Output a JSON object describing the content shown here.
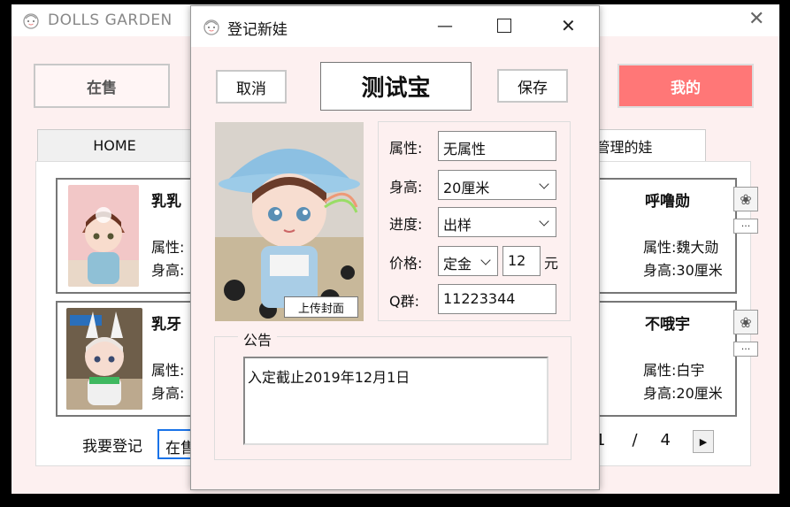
{
  "main": {
    "app_title": "DOLLS GARDEN",
    "buttons": {
      "onsale": "在售",
      "mine": "我的"
    },
    "tabs": {
      "home": "HOME",
      "managed": "管理的娃"
    },
    "cards": [
      {
        "name": "乳乳",
        "attr_label": "属性:",
        "height_label": "身高:"
      },
      {
        "name": "乳牙",
        "attr_label": "属性:",
        "height_label": "身高:"
      },
      {
        "name": "呼噜勋",
        "attr_label": "属性:",
        "attr_value": "魏大勋",
        "height_label": "身高:",
        "height_value": "30厘米",
        "more": "..."
      },
      {
        "name": "不哦宇",
        "attr_label": "属性:",
        "attr_value": "白宇",
        "height_label": "身高:",
        "height_value": "20厘米",
        "more": "..."
      }
    ],
    "register_label": "我要登记",
    "register_value": "在售",
    "pager": {
      "current": "1",
      "separator": "/",
      "total": "4"
    },
    "colors": {
      "accent": "#ff7777",
      "background": "#fdf0f0"
    }
  },
  "dialog": {
    "title": "登记新娃",
    "cancel": "取消",
    "save": "保存",
    "doll_name": "测试宝",
    "upload_cover": "上传封面",
    "form": {
      "attr_label": "属性:",
      "attr_value": "无属性",
      "height_label": "身高:",
      "height_value": "20厘米",
      "progress_label": "进度:",
      "progress_value": "出样",
      "price_label": "价格:",
      "price_type": "定金",
      "price_value": "12",
      "price_unit": "元",
      "qq_label": "Q群:",
      "qq_value": "11223344"
    },
    "notice_label": "公告",
    "notice_text": "入定截止2019年12月1日"
  }
}
